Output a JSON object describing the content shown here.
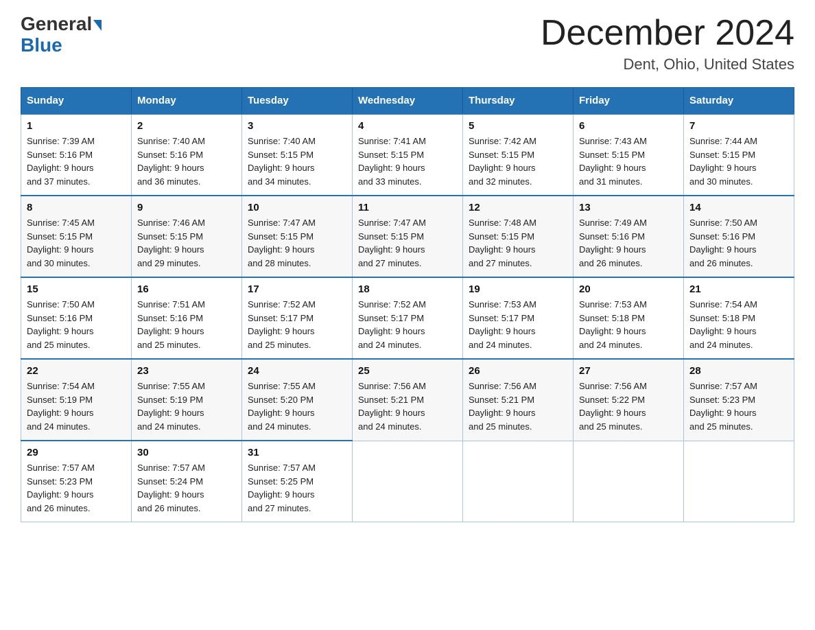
{
  "header": {
    "logo_general": "General",
    "logo_blue": "Blue",
    "title": "December 2024",
    "location": "Dent, Ohio, United States"
  },
  "days_of_week": [
    "Sunday",
    "Monday",
    "Tuesday",
    "Wednesday",
    "Thursday",
    "Friday",
    "Saturday"
  ],
  "weeks": [
    [
      {
        "day": "1",
        "sunrise": "7:39 AM",
        "sunset": "5:16 PM",
        "daylight": "9 hours and 37 minutes."
      },
      {
        "day": "2",
        "sunrise": "7:40 AM",
        "sunset": "5:16 PM",
        "daylight": "9 hours and 36 minutes."
      },
      {
        "day": "3",
        "sunrise": "7:40 AM",
        "sunset": "5:15 PM",
        "daylight": "9 hours and 34 minutes."
      },
      {
        "day": "4",
        "sunrise": "7:41 AM",
        "sunset": "5:15 PM",
        "daylight": "9 hours and 33 minutes."
      },
      {
        "day": "5",
        "sunrise": "7:42 AM",
        "sunset": "5:15 PM",
        "daylight": "9 hours and 32 minutes."
      },
      {
        "day": "6",
        "sunrise": "7:43 AM",
        "sunset": "5:15 PM",
        "daylight": "9 hours and 31 minutes."
      },
      {
        "day": "7",
        "sunrise": "7:44 AM",
        "sunset": "5:15 PM",
        "daylight": "9 hours and 30 minutes."
      }
    ],
    [
      {
        "day": "8",
        "sunrise": "7:45 AM",
        "sunset": "5:15 PM",
        "daylight": "9 hours and 30 minutes."
      },
      {
        "day": "9",
        "sunrise": "7:46 AM",
        "sunset": "5:15 PM",
        "daylight": "9 hours and 29 minutes."
      },
      {
        "day": "10",
        "sunrise": "7:47 AM",
        "sunset": "5:15 PM",
        "daylight": "9 hours and 28 minutes."
      },
      {
        "day": "11",
        "sunrise": "7:47 AM",
        "sunset": "5:15 PM",
        "daylight": "9 hours and 27 minutes."
      },
      {
        "day": "12",
        "sunrise": "7:48 AM",
        "sunset": "5:15 PM",
        "daylight": "9 hours and 27 minutes."
      },
      {
        "day": "13",
        "sunrise": "7:49 AM",
        "sunset": "5:16 PM",
        "daylight": "9 hours and 26 minutes."
      },
      {
        "day": "14",
        "sunrise": "7:50 AM",
        "sunset": "5:16 PM",
        "daylight": "9 hours and 26 minutes."
      }
    ],
    [
      {
        "day": "15",
        "sunrise": "7:50 AM",
        "sunset": "5:16 PM",
        "daylight": "9 hours and 25 minutes."
      },
      {
        "day": "16",
        "sunrise": "7:51 AM",
        "sunset": "5:16 PM",
        "daylight": "9 hours and 25 minutes."
      },
      {
        "day": "17",
        "sunrise": "7:52 AM",
        "sunset": "5:17 PM",
        "daylight": "9 hours and 25 minutes."
      },
      {
        "day": "18",
        "sunrise": "7:52 AM",
        "sunset": "5:17 PM",
        "daylight": "9 hours and 24 minutes."
      },
      {
        "day": "19",
        "sunrise": "7:53 AM",
        "sunset": "5:17 PM",
        "daylight": "9 hours and 24 minutes."
      },
      {
        "day": "20",
        "sunrise": "7:53 AM",
        "sunset": "5:18 PM",
        "daylight": "9 hours and 24 minutes."
      },
      {
        "day": "21",
        "sunrise": "7:54 AM",
        "sunset": "5:18 PM",
        "daylight": "9 hours and 24 minutes."
      }
    ],
    [
      {
        "day": "22",
        "sunrise": "7:54 AM",
        "sunset": "5:19 PM",
        "daylight": "9 hours and 24 minutes."
      },
      {
        "day": "23",
        "sunrise": "7:55 AM",
        "sunset": "5:19 PM",
        "daylight": "9 hours and 24 minutes."
      },
      {
        "day": "24",
        "sunrise": "7:55 AM",
        "sunset": "5:20 PM",
        "daylight": "9 hours and 24 minutes."
      },
      {
        "day": "25",
        "sunrise": "7:56 AM",
        "sunset": "5:21 PM",
        "daylight": "9 hours and 24 minutes."
      },
      {
        "day": "26",
        "sunrise": "7:56 AM",
        "sunset": "5:21 PM",
        "daylight": "9 hours and 25 minutes."
      },
      {
        "day": "27",
        "sunrise": "7:56 AM",
        "sunset": "5:22 PM",
        "daylight": "9 hours and 25 minutes."
      },
      {
        "day": "28",
        "sunrise": "7:57 AM",
        "sunset": "5:23 PM",
        "daylight": "9 hours and 25 minutes."
      }
    ],
    [
      {
        "day": "29",
        "sunrise": "7:57 AM",
        "sunset": "5:23 PM",
        "daylight": "9 hours and 26 minutes."
      },
      {
        "day": "30",
        "sunrise": "7:57 AM",
        "sunset": "5:24 PM",
        "daylight": "9 hours and 26 minutes."
      },
      {
        "day": "31",
        "sunrise": "7:57 AM",
        "sunset": "5:25 PM",
        "daylight": "9 hours and 27 minutes."
      },
      null,
      null,
      null,
      null
    ]
  ],
  "labels": {
    "sunrise": "Sunrise:",
    "sunset": "Sunset:",
    "daylight": "Daylight:"
  }
}
